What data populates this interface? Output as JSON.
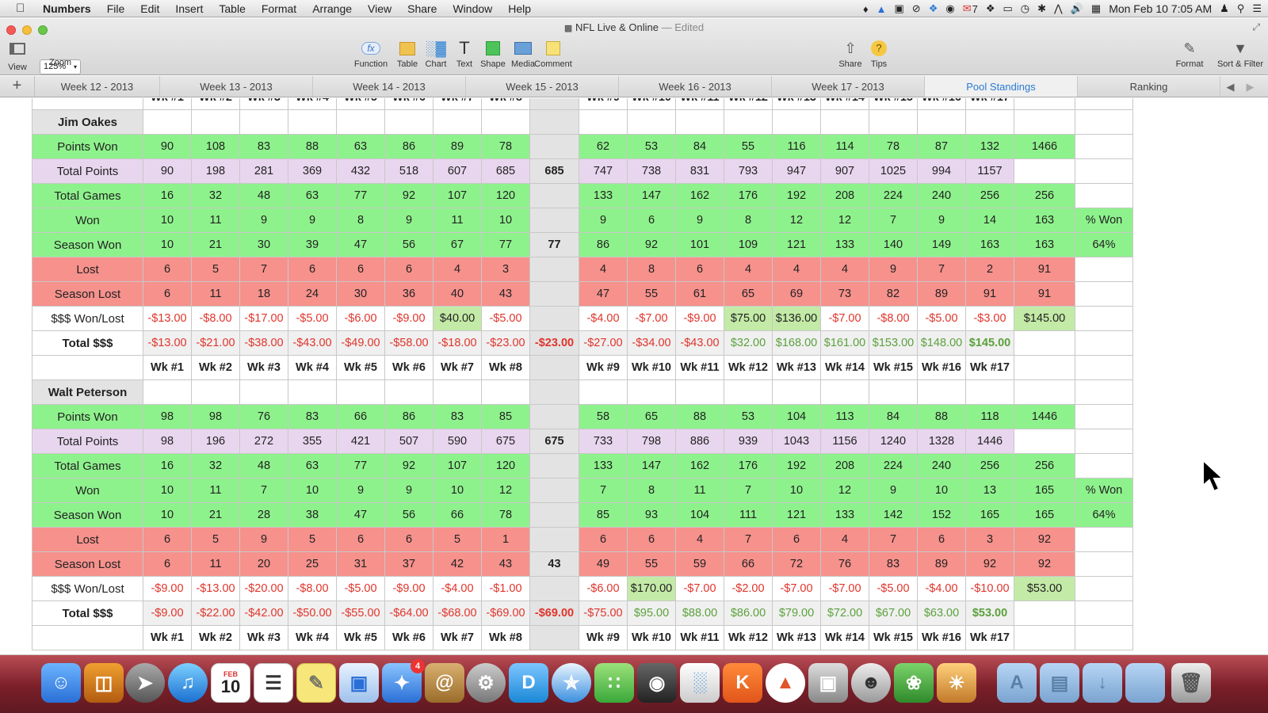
{
  "menubar": {
    "app": "Numbers",
    "items": [
      "File",
      "Edit",
      "Insert",
      "Table",
      "Format",
      "Arrange",
      "View",
      "Share",
      "Window",
      "Help"
    ],
    "mail_count": "7",
    "clock": "Mon Feb 10  7:05 AM"
  },
  "window": {
    "title": "NFL Live & Online",
    "status": "— Edited"
  },
  "toolbar": {
    "view": "View",
    "zoom": "Zoom",
    "zoom_value": "125%",
    "function": "Function",
    "table": "Table",
    "chart": "Chart",
    "text": "Text",
    "shape": "Shape",
    "media": "Media",
    "comment": "Comment",
    "share": "Share",
    "tips": "Tips",
    "format": "Format",
    "sort_filter": "Sort & Filter"
  },
  "sheets": [
    "Week 12 - 2013",
    "Week 13 - 2013",
    "Week 14 - 2013",
    "Week 15 - 2013",
    "Week 16 - 2013",
    "Week 17 - 2013",
    "Pool Standings",
    "Ranking"
  ],
  "active_sheet": "Pool Standings",
  "week_headers": [
    "Wk #1",
    "Wk #2",
    "Wk #3",
    "Wk #4",
    "Wk #5",
    "Wk #6",
    "Wk #7",
    "Wk #8",
    "",
    "Wk #9",
    "Wk #10",
    "Wk #11",
    "Wk #12",
    "Wk #13",
    "Wk #14",
    "Wk #15",
    "Wk #16",
    "Wk #17",
    "",
    ""
  ],
  "players": [
    {
      "name": "Jim Oakes",
      "rows": [
        {
          "label": "Points Won",
          "style": "g",
          "cells": [
            "90",
            "108",
            "83",
            "88",
            "63",
            "86",
            "89",
            "78",
            "",
            "62",
            "53",
            "84",
            "55",
            "116",
            "114",
            "78",
            "87",
            "132",
            "1466",
            ""
          ]
        },
        {
          "label": "Total Points",
          "style": "p",
          "cells": [
            "90",
            "198",
            "281",
            "369",
            "432",
            "518",
            "607",
            "685",
            "685",
            "747",
            "738",
            "831",
            "793",
            "947",
            "907",
            "1025",
            "994",
            "1157",
            "",
            ""
          ]
        },
        {
          "label": "Total Games",
          "style": "g",
          "cells": [
            "16",
            "32",
            "48",
            "63",
            "77",
            "92",
            "107",
            "120",
            "",
            "133",
            "147",
            "162",
            "176",
            "192",
            "208",
            "224",
            "240",
            "256",
            "256",
            ""
          ]
        },
        {
          "label": "Won",
          "style": "g",
          "cells": [
            "10",
            "11",
            "9",
            "9",
            "8",
            "9",
            "11",
            "10",
            "",
            "9",
            "6",
            "9",
            "8",
            "12",
            "12",
            "7",
            "9",
            "14",
            "163",
            "% Won"
          ]
        },
        {
          "label": "Season Won",
          "style": "g",
          "cells": [
            "10",
            "21",
            "30",
            "39",
            "47",
            "56",
            "67",
            "77",
            "77",
            "86",
            "92",
            "101",
            "109",
            "121",
            "133",
            "140",
            "149",
            "163",
            "163",
            "64%"
          ]
        },
        {
          "label": "Lost",
          "style": "r",
          "cells": [
            "6",
            "5",
            "7",
            "6",
            "6",
            "6",
            "4",
            "3",
            "",
            "4",
            "8",
            "6",
            "4",
            "4",
            "4",
            "9",
            "7",
            "2",
            "91",
            ""
          ]
        },
        {
          "label": "Season Lost",
          "style": "r",
          "cells": [
            "6",
            "11",
            "18",
            "24",
            "30",
            "36",
            "40",
            "43",
            "",
            "47",
            "55",
            "61",
            "65",
            "69",
            "73",
            "82",
            "89",
            "91",
            "91",
            ""
          ]
        },
        {
          "label": "$$$ Won/Lost",
          "style": "w",
          "cells": [
            "-$13.00",
            "-$8.00",
            "-$17.00",
            "-$5.00",
            "-$6.00",
            "-$9.00",
            "$40.00",
            "-$5.00",
            "",
            "-$4.00",
            "-$7.00",
            "-$9.00",
            "$75.00",
            "$136.00",
            "-$7.00",
            "-$8.00",
            "-$5.00",
            "-$3.00",
            "$145.00",
            ""
          ]
        },
        {
          "label": "Total $$$",
          "style": "t",
          "cells": [
            "-$13.00",
            "-$21.00",
            "-$38.00",
            "-$43.00",
            "-$49.00",
            "-$58.00",
            "-$18.00",
            "-$23.00",
            "-$23.00",
            "-$27.00",
            "-$34.00",
            "-$43.00",
            "$32.00",
            "$168.00",
            "$161.00",
            "$153.00",
            "$148.00",
            "$145.00",
            "",
            ""
          ]
        }
      ]
    },
    {
      "name": "Walt Peterson",
      "rows": [
        {
          "label": "Points Won",
          "style": "g",
          "cells": [
            "98",
            "98",
            "76",
            "83",
            "66",
            "86",
            "83",
            "85",
            "",
            "58",
            "65",
            "88",
            "53",
            "104",
            "113",
            "84",
            "88",
            "118",
            "1446",
            ""
          ]
        },
        {
          "label": "Total Points",
          "style": "p",
          "cells": [
            "98",
            "196",
            "272",
            "355",
            "421",
            "507",
            "590",
            "675",
            "675",
            "733",
            "798",
            "886",
            "939",
            "1043",
            "1156",
            "1240",
            "1328",
            "1446",
            "",
            ""
          ]
        },
        {
          "label": "Total Games",
          "style": "g",
          "cells": [
            "16",
            "32",
            "48",
            "63",
            "77",
            "92",
            "107",
            "120",
            "",
            "133",
            "147",
            "162",
            "176",
            "192",
            "208",
            "224",
            "240",
            "256",
            "256",
            ""
          ]
        },
        {
          "label": "Won",
          "style": "g",
          "cells": [
            "10",
            "11",
            "7",
            "10",
            "9",
            "9",
            "10",
            "12",
            "",
            "7",
            "8",
            "11",
            "7",
            "10",
            "12",
            "9",
            "10",
            "13",
            "165",
            "% Won"
          ]
        },
        {
          "label": "Season Won",
          "style": "g",
          "cells": [
            "10",
            "21",
            "28",
            "38",
            "47",
            "56",
            "66",
            "78",
            "",
            "85",
            "93",
            "104",
            "111",
            "121",
            "133",
            "142",
            "152",
            "165",
            "165",
            "64%"
          ]
        },
        {
          "label": "Lost",
          "style": "r",
          "cells": [
            "6",
            "5",
            "9",
            "5",
            "6",
            "6",
            "5",
            "1",
            "",
            "6",
            "6",
            "4",
            "7",
            "6",
            "4",
            "7",
            "6",
            "3",
            "92",
            ""
          ]
        },
        {
          "label": "Season Lost",
          "style": "r",
          "cells": [
            "6",
            "11",
            "20",
            "25",
            "31",
            "37",
            "42",
            "43",
            "43",
            "49",
            "55",
            "59",
            "66",
            "72",
            "76",
            "83",
            "89",
            "92",
            "92",
            ""
          ]
        },
        {
          "label": "$$$ Won/Lost",
          "style": "w",
          "cells": [
            "-$9.00",
            "-$13.00",
            "-$20.00",
            "-$8.00",
            "-$5.00",
            "-$9.00",
            "-$4.00",
            "-$1.00",
            "",
            "-$6.00",
            "$170.00",
            "-$7.00",
            "-$2.00",
            "-$7.00",
            "-$7.00",
            "-$5.00",
            "-$4.00",
            "-$10.00",
            "$53.00",
            ""
          ]
        },
        {
          "label": "Total $$$",
          "style": "t",
          "cells": [
            "-$9.00",
            "-$22.00",
            "-$42.00",
            "-$50.00",
            "-$55.00",
            "-$64.00",
            "-$68.00",
            "-$69.00",
            "-$69.00",
            "-$75.00",
            "$95.00",
            "$88.00",
            "$86.00",
            "$79.00",
            "$72.00",
            "$67.00",
            "$63.00",
            "$53.00",
            "",
            ""
          ]
        }
      ]
    }
  ],
  "dock": {
    "mail_badge": "4",
    "calendar_month": "FEB",
    "calendar_day": "10"
  }
}
